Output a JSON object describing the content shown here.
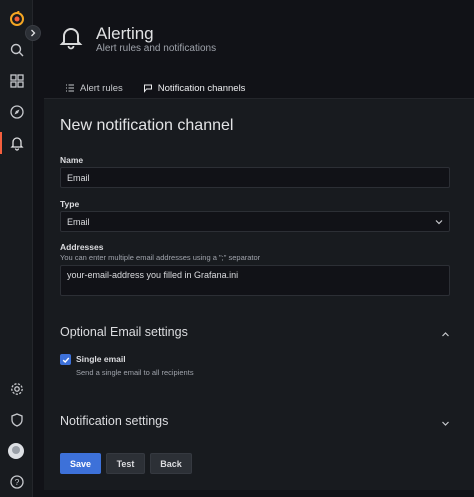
{
  "header": {
    "title": "Alerting",
    "subtitle": "Alert rules and notifications"
  },
  "tabs": [
    {
      "label": "Alert rules",
      "icon": "list-icon",
      "active": false
    },
    {
      "label": "Notification channels",
      "icon": "comment-alt-share-icon",
      "active": true
    }
  ],
  "sidebar": {
    "items": [
      {
        "name": "grafana-logo",
        "icon": "grafana-logo-icon"
      },
      {
        "name": "search",
        "icon": "search-icon"
      },
      {
        "name": "dashboards",
        "icon": "apps-icon"
      },
      {
        "name": "explore",
        "icon": "compass-icon"
      },
      {
        "name": "alerting",
        "icon": "bell-icon",
        "active": true
      },
      {
        "name": "configuration",
        "icon": "cog-icon"
      },
      {
        "name": "server-admin",
        "icon": "shield-icon"
      },
      {
        "name": "profile",
        "icon": "avatar"
      },
      {
        "name": "help",
        "icon": "question-circle-icon"
      }
    ],
    "accent_color": "#f55f3e"
  },
  "form": {
    "title": "New notification channel",
    "name_label": "Name",
    "name_value": "Email",
    "type_label": "Type",
    "type_value": "Email",
    "addresses_label": "Addresses",
    "addresses_desc": "You can enter multiple email addresses using a \";\" separator",
    "addresses_value": "your-email-address you filled in Grafana.ini",
    "optional_section": "Optional Email settings",
    "single_email_label": "Single email",
    "single_email_desc": "Send a single email to all recipients",
    "single_email_checked": true,
    "notification_section": "Notification settings"
  },
  "buttons": {
    "save": "Save",
    "test": "Test",
    "back": "Back"
  },
  "colors": {
    "primary": "#3d71d9",
    "accent": "#f55f3e",
    "panel": "#181b1f",
    "background": "#111217"
  }
}
